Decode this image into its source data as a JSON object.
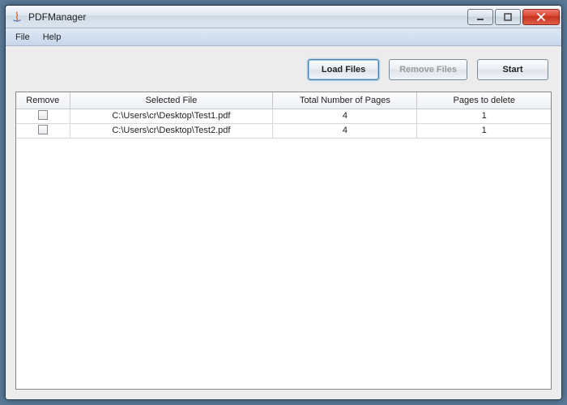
{
  "window": {
    "title": "PDFManager"
  },
  "menu": {
    "file": "File",
    "help": "Help"
  },
  "buttons": {
    "load": "Load Files",
    "remove": "Remove Files",
    "start": "Start"
  },
  "table": {
    "headers": {
      "remove": "Remove",
      "file": "Selected File",
      "pages": "Total Number of Pages",
      "delete": "Pages to delete"
    },
    "rows": [
      {
        "file": "C:\\Users\\cr\\Desktop\\Test1.pdf",
        "pages": "4",
        "delete": "1"
      },
      {
        "file": "C:\\Users\\cr\\Desktop\\Test2.pdf",
        "pages": "4",
        "delete": "1"
      }
    ]
  }
}
